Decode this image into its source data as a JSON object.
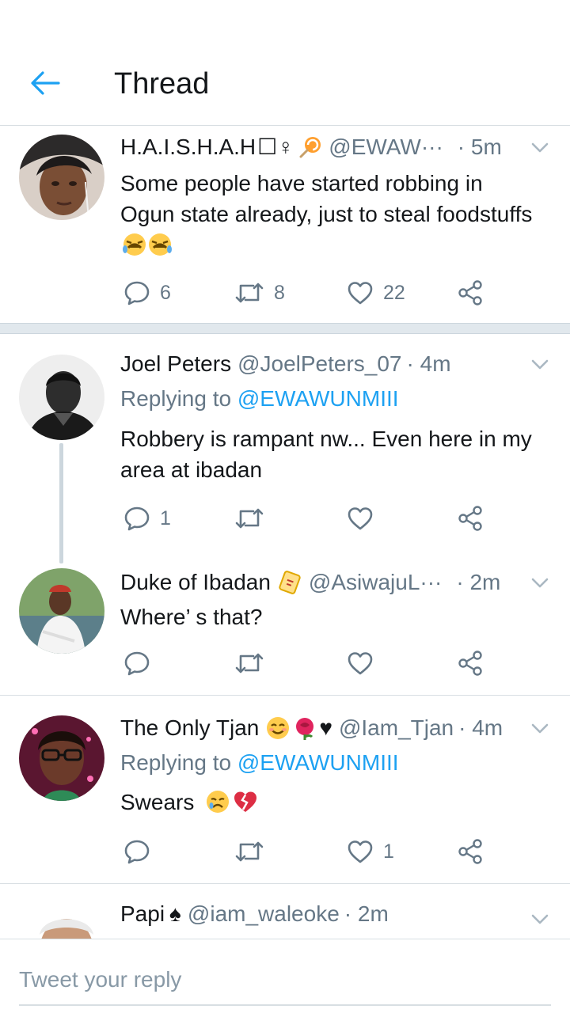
{
  "header": {
    "title": "Thread"
  },
  "tweets": [
    {
      "name": "H.A.I.S.H.A.H",
      "name_symbols": "☐♀",
      "handle": "@EWAW···",
      "time": "· 5m",
      "text": "Some people have started robbing in Ogun state already, just to steal foodstuffs",
      "counts": {
        "reply": "6",
        "retweet": "8",
        "like": "22"
      }
    },
    {
      "name": "Joel Peters",
      "handle": "@JoelPeters_07",
      "time": "· 4m",
      "replying_prefix": "Replying to",
      "replying_to": "@EWAWUNMIII",
      "text": "Robbery is rampant nw... Even here in my area at ibadan",
      "counts": {
        "reply": "1",
        "retweet": "",
        "like": ""
      }
    },
    {
      "name": "Duke of Ibadan",
      "handle": "@AsiwajuL···",
      "time": "· 2m",
      "text": "Where’ s that?",
      "counts": {
        "reply": "",
        "retweet": "",
        "like": ""
      }
    },
    {
      "name": "The Only Tjan",
      "name_symbols": "♥",
      "handle": "@Iam_Tjan",
      "time": "· 4m",
      "replying_prefix": "Replying to",
      "replying_to": "@EWAWUNMIII",
      "text": "Swears",
      "counts": {
        "reply": "",
        "retweet": "",
        "like": "1"
      }
    },
    {
      "name": "Papi",
      "name_symbols": "♠",
      "handle": "@iam_waleoke",
      "time": "· 2m"
    }
  ],
  "reply_bar": {
    "placeholder": "Tweet your reply"
  },
  "colors": {
    "accent": "#1da1f2",
    "secondary_text": "#657786",
    "border": "#d8dfe3"
  }
}
